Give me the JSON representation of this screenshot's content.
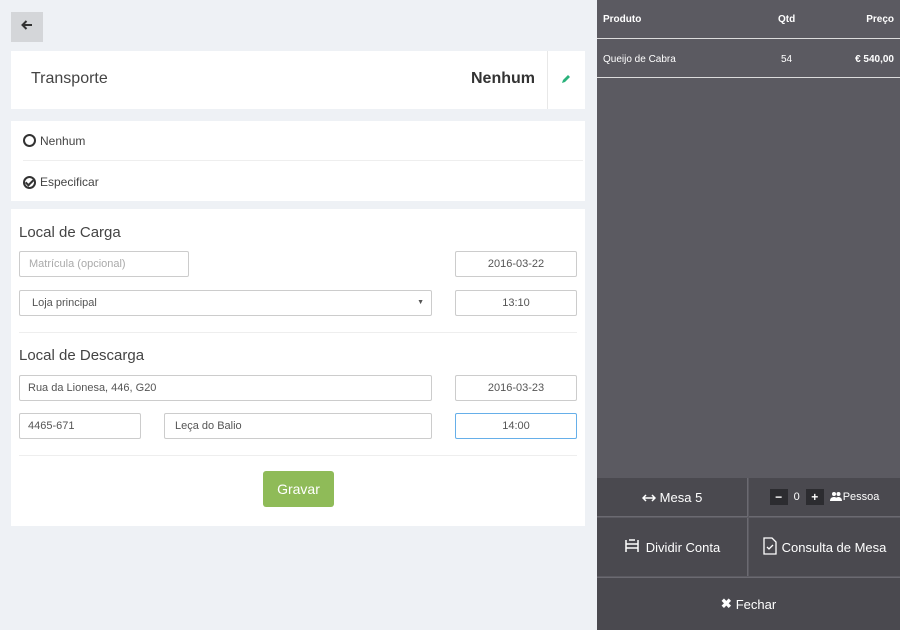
{
  "nav": {
    "back_icon": "arrow-left-icon"
  },
  "transport": {
    "title": "Transporte",
    "value": "Nenhum"
  },
  "options": [
    {
      "label": "Nenhum",
      "checked": false
    },
    {
      "label": "Especificar",
      "checked": true
    }
  ],
  "loading": {
    "title": "Local de Carga",
    "plate_placeholder": "Matrícula (opcional)",
    "date": "2016-03-22",
    "location": "Loja principal",
    "time": "13:10"
  },
  "unloading": {
    "title": "Local de Descarga",
    "address": "Rua da Lionesa, 446, G20",
    "date": "2016-03-23",
    "postal_code": "4465-671",
    "city": "Leça do Balio",
    "time": "14:00"
  },
  "save_label": "Gravar",
  "order": {
    "headers": {
      "product": "Produto",
      "qty": "Qtd",
      "price": "Preço"
    },
    "rows": [
      {
        "product": "Queijo de Cabra",
        "qty": "54",
        "price": "€ 540,00"
      }
    ]
  },
  "actions": {
    "table_label": "Mesa 5",
    "people_count": "0",
    "people_label": "Pessoa",
    "split_label": "Dividir Conta",
    "consult_label": "Consulta de Mesa",
    "close_label": "Fechar"
  },
  "colors": {
    "panel_bg": "#5b5a61",
    "save_green": "#8fbb58",
    "edit_green": "#2ab27b",
    "page_bg": "#eef1f5"
  }
}
